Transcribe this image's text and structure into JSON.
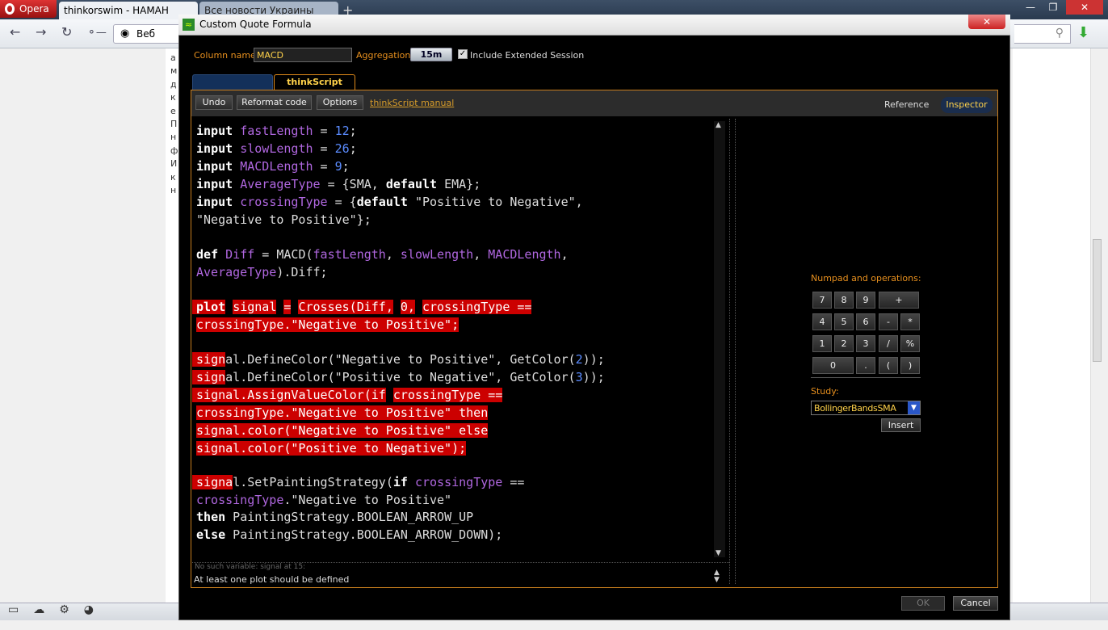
{
  "browser": {
    "opera_label": "Opera",
    "tabs": [
      {
        "label": "thinkorswim - НАМАН"
      },
      {
        "label": "Все новости Украины"
      }
    ],
    "add_tab": "+",
    "address_text": "Веб",
    "left_page_text": "а\nм\nд\nк\nе\nП\nн\nф\nИ\nк\nн",
    "window_controls": [
      "—",
      "❐",
      "✕"
    ]
  },
  "dialog": {
    "title": "Custom Quote Formula",
    "close_label": "✕",
    "column_name_label": "Column name:",
    "column_name_value": "MACD",
    "aggregation_label": "Aggregation:",
    "aggregation_value": "15m",
    "include_extended_label": "Include Extended Session",
    "include_extended_checked": true,
    "tabs": {
      "active": "thinkScript Editor"
    },
    "toolbar": {
      "undo": "Undo",
      "reformat": "Reformat code",
      "options": "Options",
      "manual_link": "thinkScript manual",
      "reference": "Reference",
      "inspector": "Inspector"
    },
    "code_lines": [
      [
        {
          "t": "input",
          "c": "kw"
        },
        {
          "t": " ",
          "c": ""
        },
        {
          "t": "fastLength",
          "c": "id"
        },
        {
          "t": " = ",
          "c": "pl"
        },
        {
          "t": "12",
          "c": "num"
        },
        {
          "t": ";",
          "c": "pl"
        }
      ],
      [
        {
          "t": " input",
          "c": "kw"
        },
        {
          "t": " ",
          "c": ""
        },
        {
          "t": "slowLength",
          "c": "id"
        },
        {
          "t": " = ",
          "c": "pl"
        },
        {
          "t": "26",
          "c": "num"
        },
        {
          "t": ";",
          "c": "pl"
        }
      ],
      [
        {
          "t": " input",
          "c": "kw"
        },
        {
          "t": " ",
          "c": ""
        },
        {
          "t": "MACDLength",
          "c": "id"
        },
        {
          "t": " = ",
          "c": "pl"
        },
        {
          "t": "9",
          "c": "num"
        },
        {
          "t": ";",
          "c": "pl"
        }
      ],
      [
        {
          "t": " input",
          "c": "kw"
        },
        {
          "t": " ",
          "c": ""
        },
        {
          "t": "AverageType",
          "c": "id"
        },
        {
          "t": " = {SMA, ",
          "c": "pl"
        },
        {
          "t": "default",
          "c": "kw"
        },
        {
          "t": " EMA};",
          "c": "pl"
        }
      ],
      [
        {
          "t": " input",
          "c": "kw"
        },
        {
          "t": " ",
          "c": ""
        },
        {
          "t": "crossingType",
          "c": "id"
        },
        {
          "t": " = {",
          "c": "pl"
        },
        {
          "t": "default",
          "c": "kw"
        },
        {
          "t": " \"Positive to Negative\",",
          "c": "pl"
        }
      ],
      [
        {
          "t": "\"Negative to Positive\"};",
          "c": "pl"
        }
      ],
      [],
      [
        {
          "t": " def",
          "c": "kw"
        },
        {
          "t": " ",
          "c": ""
        },
        {
          "t": "Diff",
          "c": "id"
        },
        {
          "t": " = MACD(",
          "c": "pl"
        },
        {
          "t": "fastLength",
          "c": "id"
        },
        {
          "t": ", ",
          "c": "pl"
        },
        {
          "t": "slowLength",
          "c": "id"
        },
        {
          "t": ", ",
          "c": "pl"
        },
        {
          "t": "MACDLength",
          "c": "id"
        },
        {
          "t": ",",
          "c": "pl"
        }
      ],
      [
        {
          "t": "AverageType",
          "c": "id"
        },
        {
          "t": ").Diff;",
          "c": "pl"
        }
      ],
      [],
      [
        {
          "t": " plot",
          "c": "kw hl"
        },
        {
          "t": " ",
          "c": ""
        },
        {
          "t": "signal",
          "c": "hl"
        },
        {
          "t": " ",
          "c": ""
        },
        {
          "t": "=",
          "c": "hl"
        },
        {
          "t": " ",
          "c": ""
        },
        {
          "t": "Crosses(Diff,",
          "c": "hl"
        },
        {
          "t": " ",
          "c": ""
        },
        {
          "t": "0,",
          "c": "hl"
        },
        {
          "t": " ",
          "c": ""
        },
        {
          "t": "crossingType ==",
          "c": "hl"
        }
      ],
      [
        {
          "t": "crossingType.\"Negative to Positive\";",
          "c": "hl"
        }
      ],
      [],
      [
        {
          "t": " sign",
          "c": "hl"
        },
        {
          "t": "al.DefineColor(\"Negative to Positive\", GetColor(",
          "c": "pl"
        },
        {
          "t": "2",
          "c": "num"
        },
        {
          "t": "));",
          "c": "pl"
        }
      ],
      [
        {
          "t": " sign",
          "c": "hl"
        },
        {
          "t": "al.DefineColor(\"Positive to Negative\", GetColor(",
          "c": "pl"
        },
        {
          "t": "3",
          "c": "num"
        },
        {
          "t": "));",
          "c": "pl"
        }
      ],
      [
        {
          "t": " signal.AssignValueColor(if",
          "c": "hl"
        },
        {
          "t": " ",
          "c": ""
        },
        {
          "t": "crossingType ==",
          "c": "hl"
        }
      ],
      [
        {
          "t": "crossingType.\"Negative to Positive\" then",
          "c": "hl"
        }
      ],
      [
        {
          "t": "signal.color(\"Negative to Positive\" else",
          "c": "hl"
        }
      ],
      [
        {
          "t": "signal.color(\"Positive to Negative\");",
          "c": "hl"
        }
      ],
      [],
      [
        {
          "t": " signa",
          "c": "hl"
        },
        {
          "t": "l.SetPaintingStrategy(",
          "c": "pl"
        },
        {
          "t": "if",
          "c": "kw"
        },
        {
          "t": " ",
          "c": ""
        },
        {
          "t": "crossingType",
          "c": "id"
        },
        {
          "t": " ==",
          "c": "pl"
        }
      ],
      [
        {
          "t": "crossingType",
          "c": "id"
        },
        {
          "t": ".\"Negative to Positive\"",
          "c": "pl"
        }
      ],
      [
        {
          "t": " then",
          "c": "kw"
        },
        {
          "t": " PaintingStrategy.BOOLEAN_ARROW_UP",
          "c": "pl"
        }
      ],
      [
        {
          "t": " else",
          "c": "kw"
        },
        {
          "t": " PaintingStrategy.BOOLEAN_ARROW_DOWN);",
          "c": "pl"
        }
      ]
    ],
    "message_old": "No such variable: signal at 15:",
    "message": "At least one plot should be defined",
    "numpad_label": "Numpad and operations:",
    "numpad_keys": [
      "7",
      "8",
      "9",
      "+",
      "4",
      "5",
      "6",
      "-",
      "*",
      "1",
      "2",
      "3",
      "/",
      "%",
      "0",
      ".",
      "(",
      ")"
    ],
    "study_label": "Study:",
    "study_value": "BollingerBandsSMA",
    "insert_label": "Insert",
    "ok_label": "OK",
    "cancel_label": "Cancel"
  }
}
